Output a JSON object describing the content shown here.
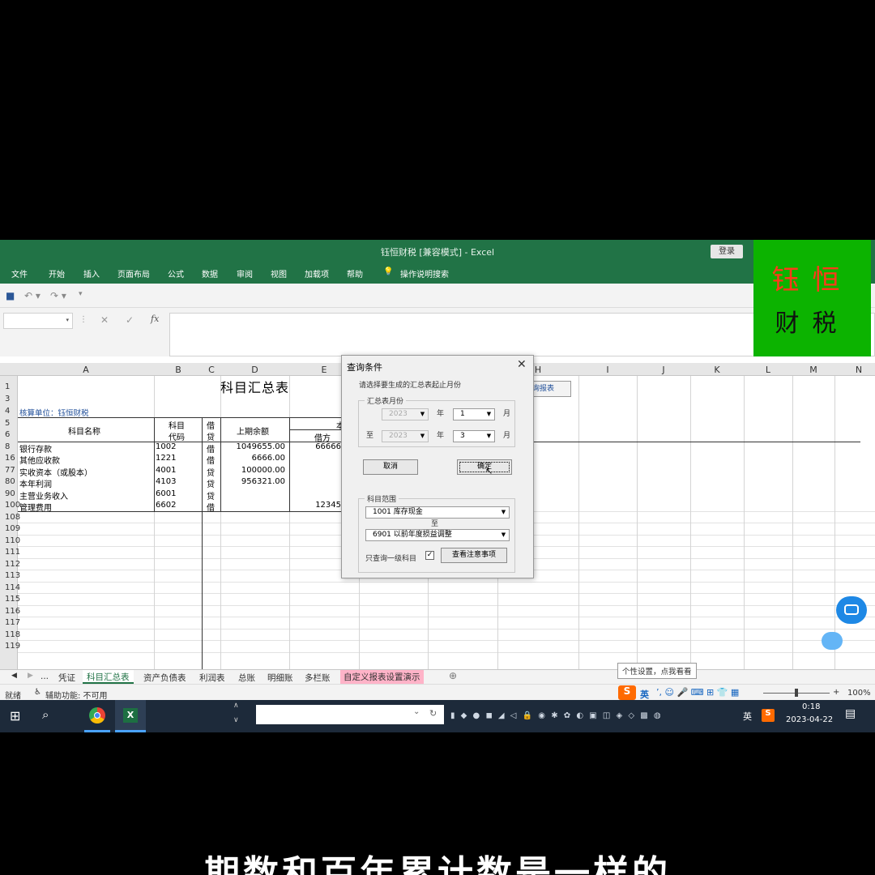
{
  "window": {
    "title": "钰恒财税  [兼容模式]  -  Excel",
    "login": "登录"
  },
  "ribbon": {
    "tabs": [
      "文件",
      "开始",
      "插入",
      "页面布局",
      "公式",
      "数据",
      "审阅",
      "视图",
      "加载项",
      "帮助",
      "操作说明搜索"
    ]
  },
  "formula": {
    "cancel": "✕",
    "confirm": "✓",
    "fx": "fx"
  },
  "brand": {
    "top": "钰恒",
    "bottom": "财税"
  },
  "columns": [
    "A",
    "B",
    "C",
    "D",
    "E",
    "H",
    "I",
    "J",
    "K",
    "L",
    "M",
    "N"
  ],
  "sheet": {
    "title": "科目汇总表",
    "unit": "核算单位：钰恒财税",
    "headers": {
      "name": "科目名称",
      "code_1": "科目",
      "code_2": "代码",
      "dc_1": "借",
      "dc_2": "贷",
      "prev": "上期余额",
      "partial": "本",
      "debit": "借方"
    },
    "rows": [
      {
        "num": "8",
        "name": "银行存款",
        "code": "1002",
        "dc": "借",
        "prev": "1049655.00",
        "debit": "66666"
      },
      {
        "num": "16",
        "name": "其他应收款",
        "code": "1221",
        "dc": "借",
        "prev": "6666.00",
        "debit": ""
      },
      {
        "num": "77",
        "name": "实收资本（或股本）",
        "code": "4001",
        "dc": "贷",
        "prev": "100000.00",
        "debit": ""
      },
      {
        "num": "80",
        "name": "本年利润",
        "code": "4103",
        "dc": "贷",
        "prev": "956321.00",
        "debit": ""
      },
      {
        "num": "90",
        "name": "主营业务收入",
        "code": "6001",
        "dc": "贷",
        "prev": "",
        "debit": ""
      },
      {
        "num": "100",
        "name": "管理费用",
        "code": "6602",
        "dc": "借",
        "prev": "",
        "debit": "12345"
      }
    ],
    "header_row_nums": [
      "1",
      "3",
      "4",
      "5",
      "6"
    ],
    "empty_row_nums": [
      "108",
      "109",
      "110",
      "111",
      "112",
      "113",
      "114",
      "115",
      "116",
      "117",
      "118",
      "119"
    ],
    "query_button": "询报表"
  },
  "dialog": {
    "title": "查询条件",
    "prompt": "请选择要生成的汇总表起止月份",
    "month_group": "汇总表月份",
    "from_year": "2023",
    "from_month": "1",
    "to_label": "至",
    "to_year": "2023",
    "to_month": "3",
    "year_label": "年",
    "month_label": "月",
    "cancel": "取消",
    "ok": "确定",
    "subject_group": "科目范围",
    "from_subject": "1001        库存现金",
    "to_subject": "6901        以前年度损益调整",
    "only_first_level": "只查询一级科目",
    "check_mark": "✓",
    "notes_button": "查看注意事项"
  },
  "sheet_tabs": [
    "...",
    "凭证",
    "科目汇总表",
    "资产负债表",
    "利润表",
    "总账",
    "明细账",
    "多栏账",
    "自定义报表设置演示"
  ],
  "status": {
    "ready": "就绪",
    "accessibility": "辅助功能: 不可用",
    "zoom": "100%",
    "tooltip": "个性设置，点我看看",
    "ime": "英"
  },
  "taskbar": {
    "time": "0:18",
    "date": "2023-04-22",
    "lang": "英"
  },
  "subtitle": "期数和百年累计数是一样的"
}
